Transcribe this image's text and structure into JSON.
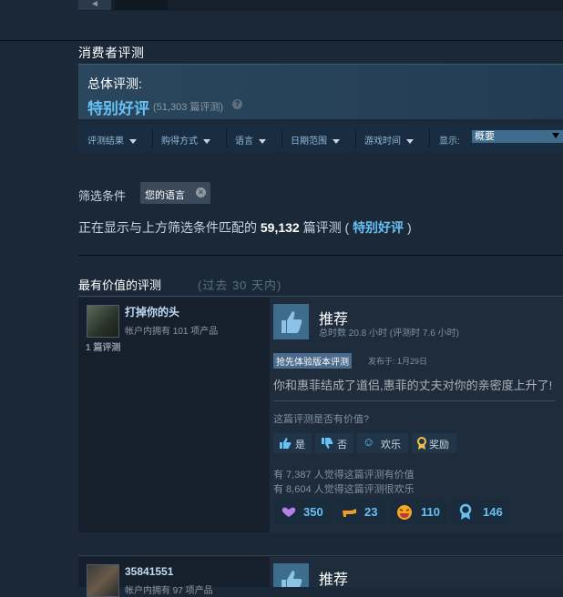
{
  "top_nav": {
    "arrow": "◄"
  },
  "section_title": "消费者评测",
  "summary": {
    "label": "总体评测:",
    "value": "特别好评",
    "count": "(51,303 篇评测)",
    "help": "?"
  },
  "filters": {
    "items": [
      {
        "label": "评测结果"
      },
      {
        "label": "购得方式"
      },
      {
        "label": "语言"
      },
      {
        "label": "日期范围"
      },
      {
        "label": "游戏时间"
      }
    ],
    "display_label": "显示:",
    "display_value": "概要"
  },
  "active_filters": {
    "label": "筛选条件",
    "chip": "您的语言",
    "chip_close": "×"
  },
  "showing": {
    "prefix": "正在显示与上方筛选条件匹配的",
    "count": "59,132",
    "mid": "篇评测 (",
    "rating": "特别好评",
    "suffix": ")"
  },
  "most_helpful": {
    "title": "最有价值的评测",
    "range": "(过去 30 天内)"
  },
  "reviews": [
    {
      "author": "打掉你的头",
      "owned": "帐户内拥有 101 项产品",
      "review_count": "1 篇评测",
      "recommendation": "推荐",
      "hours": "总时数 20.8 小时 (评测时 7.6 小时)",
      "tag": "抢先体验版本评测",
      "posted": "发布于: 1月29日",
      "text": "你和惠菲结成了道侣,惠菲的丈夫对你的亲密度上升了!",
      "helpful_question": "这篇评测是否有价值?",
      "buttons": {
        "yes": "是",
        "no": "否",
        "funny": "欢乐",
        "award": "奖励"
      },
      "found_helpful": "有 7,387 人觉得这篇评测有价值",
      "found_funny": "有 8,604 人觉得这篇评测很欢乐",
      "awards": [
        "350",
        "23",
        "110",
        "146"
      ]
    },
    {
      "author": "35841551",
      "owned": "帐户内拥有 97 项产品",
      "recommendation": "推荐"
    }
  ],
  "colors": {
    "accent": "#66c0f4",
    "background": "#1b2838"
  }
}
